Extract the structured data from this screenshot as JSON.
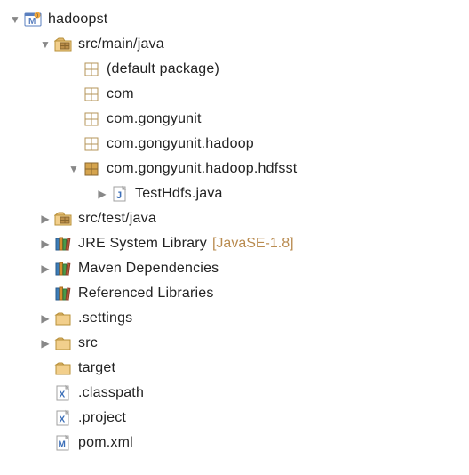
{
  "tree": [
    {
      "level": 0,
      "arrow": "open",
      "icon": "maven-project",
      "label": "hadoopst"
    },
    {
      "level": 1,
      "arrow": "open",
      "icon": "source-folder",
      "label": "src/main/java"
    },
    {
      "level": 2,
      "arrow": "blank",
      "icon": "package-empty",
      "label": "(default package)"
    },
    {
      "level": 2,
      "arrow": "blank",
      "icon": "package-empty",
      "label": "com"
    },
    {
      "level": 2,
      "arrow": "blank",
      "icon": "package-empty",
      "label": "com.gongyunit"
    },
    {
      "level": 2,
      "arrow": "blank",
      "icon": "package-empty",
      "label": "com.gongyunit.hadoop"
    },
    {
      "level": 2,
      "arrow": "open",
      "icon": "package",
      "label": "com.gongyunit.hadoop.hdfsst"
    },
    {
      "level": 3,
      "arrow": "closed",
      "icon": "java-file",
      "label": "TestHdfs.java"
    },
    {
      "level": 1,
      "arrow": "closed",
      "icon": "source-folder",
      "label": "src/test/java"
    },
    {
      "level": 1,
      "arrow": "closed",
      "icon": "library",
      "label": "JRE System Library",
      "qualifier": "[JavaSE-1.8]"
    },
    {
      "level": 1,
      "arrow": "closed",
      "icon": "library",
      "label": "Maven Dependencies"
    },
    {
      "level": 1,
      "arrow": "blank",
      "icon": "library",
      "label": "Referenced Libraries"
    },
    {
      "level": 1,
      "arrow": "closed",
      "icon": "folder",
      "label": ".settings"
    },
    {
      "level": 1,
      "arrow": "closed",
      "icon": "folder",
      "label": "src"
    },
    {
      "level": 1,
      "arrow": "blank",
      "icon": "folder",
      "label": "target"
    },
    {
      "level": 1,
      "arrow": "blank",
      "icon": "xml-file",
      "label": ".classpath"
    },
    {
      "level": 1,
      "arrow": "blank",
      "icon": "xml-file",
      "label": ".project"
    },
    {
      "level": 1,
      "arrow": "blank",
      "icon": "m-file",
      "label": "pom.xml"
    }
  ]
}
